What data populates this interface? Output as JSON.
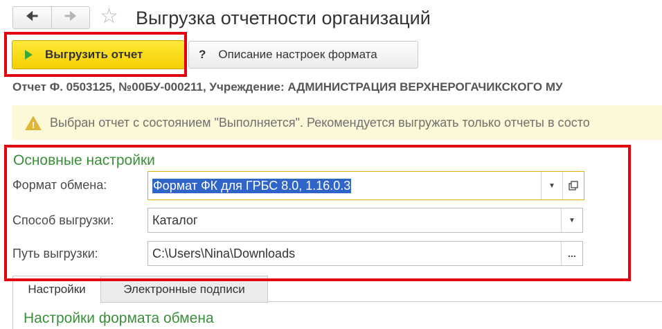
{
  "header": {
    "back_icon": "arrow-left-icon",
    "forward_icon": "arrow-right-icon",
    "favorite_icon": "star-icon",
    "title": "Выгрузка отчетности организаций"
  },
  "toolbar": {
    "export_label": "Выгрузить отчет",
    "help_label": "Описание настроек формата",
    "help_symbol": "?"
  },
  "report_line": "Отчет Ф. 0503125, №00БУ-000211, Учреждение: АДМИНИСТРАЦИЯ ВЕРХНЕРОГАЧИКСКОГО МУ",
  "warning": {
    "icon": "warning-icon",
    "text": "Выбран отчет с состоянием \"Выполняется\". Рекомендуется выгружать только отчеты в состо"
  },
  "main_settings": {
    "title": "Основные настройки",
    "format_label": "Формат обмена:",
    "format_value": "Формат ФК для ГРБС 8.0, 1.16.0.3",
    "method_label": "Способ выгрузки:",
    "method_value": "Каталог",
    "path_label": "Путь выгрузки:",
    "path_value": "C:\\Users\\Nina\\Downloads",
    "path_button": "..."
  },
  "tabs": [
    {
      "label": "Настройки",
      "active": true
    },
    {
      "label": "Электронные подписи",
      "active": false
    }
  ],
  "exchange_settings_title": "Настройки формата обмена",
  "colors": {
    "accent_yellow": "#f5cf00",
    "section_green": "#3a8f3a",
    "highlight_red": "#e3000f",
    "selection_blue": "#2f64c8"
  }
}
